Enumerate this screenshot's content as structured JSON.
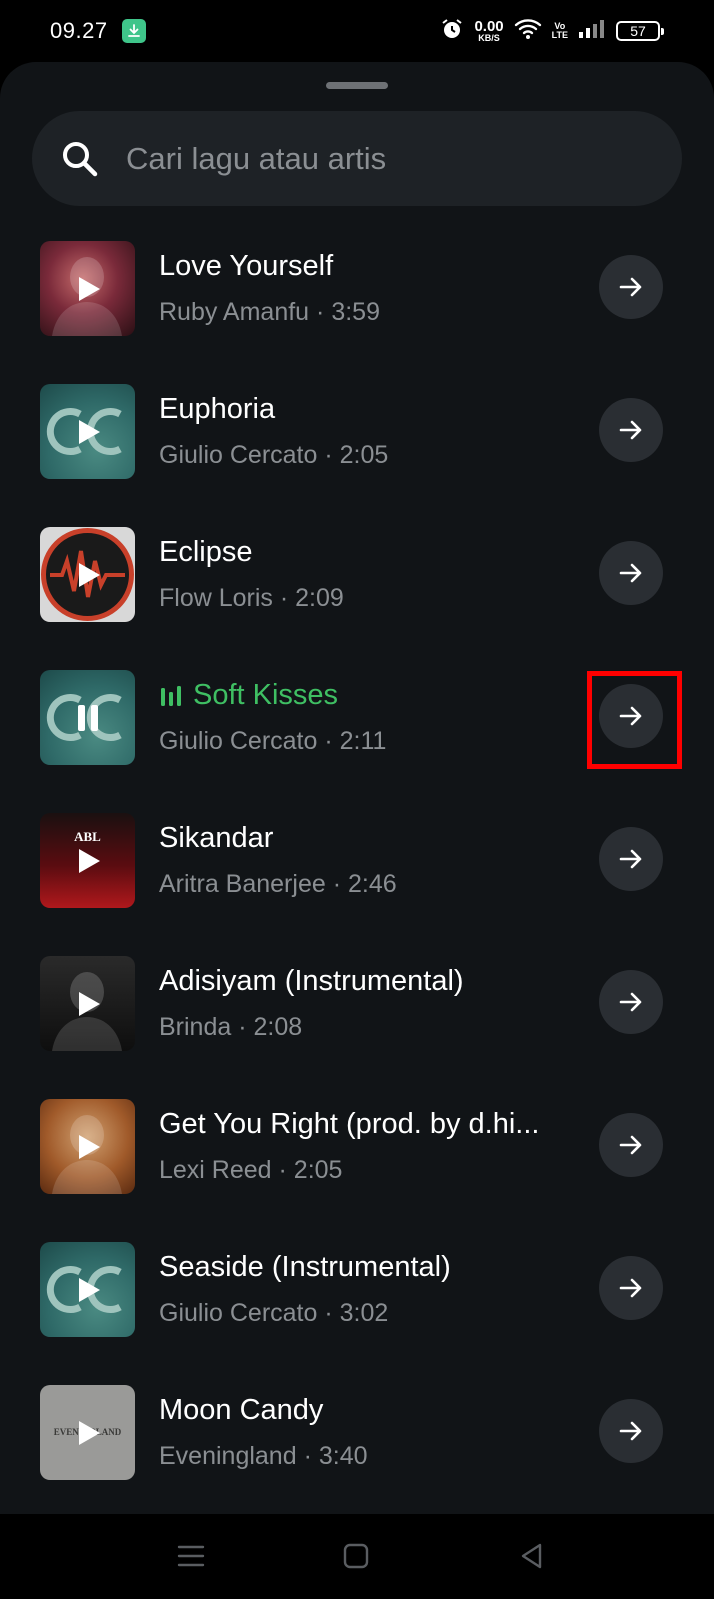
{
  "status_bar": {
    "time": "09.27",
    "net_speed_value": "0.00",
    "net_speed_unit": "KB/S",
    "volte_top": "Vo",
    "volte_bottom": "LTE",
    "battery": "57"
  },
  "search": {
    "placeholder": "Cari lagu atau artis",
    "value": ""
  },
  "songs": [
    {
      "title": "Love Yourself",
      "artist": "Ruby Amanfu",
      "duration": "3:59",
      "state": "play"
    },
    {
      "title": "Euphoria",
      "artist": "Giulio Cercato",
      "duration": "2:05",
      "state": "play"
    },
    {
      "title": "Eclipse",
      "artist": "Flow Loris",
      "duration": "2:09",
      "state": "play"
    },
    {
      "title": "Soft Kisses",
      "artist": "Giulio Cercato",
      "duration": "2:11",
      "state": "pause"
    },
    {
      "title": "Sikandar",
      "artist": "Aritra Banerjee",
      "duration": "2:46",
      "state": "play",
      "art_text": "ABL"
    },
    {
      "title": "Adisiyam (Instrumental)",
      "artist": "Brinda",
      "duration": "2:08",
      "state": "play"
    },
    {
      "title": "Get You Right (prod. by d.hi...",
      "artist": "Lexi Reed",
      "duration": "2:05",
      "state": "play"
    },
    {
      "title": "Seaside (Instrumental)",
      "artist": "Giulio Cercato",
      "duration": "3:02",
      "state": "play"
    },
    {
      "title": "Moon Candy",
      "artist": "Eveningland",
      "duration": "3:40",
      "state": "play",
      "art_text": "EVENINGLAND"
    }
  ],
  "subtitle_separator": " · ",
  "colors": {
    "sheet_bg": "#111417",
    "search_bg": "#1e2226",
    "now_playing_green": "#3fbf63",
    "secondary_text": "#8b8f93",
    "button_bg": "#2a2e33",
    "highlight_red": "#ff0000"
  },
  "icons": {
    "search": "search-icon",
    "row_action": "arrow-right-icon",
    "playing_indicator": "equalizer-icon",
    "nav_recents": "menu-icon",
    "nav_home": "square-icon",
    "nav_back": "back-triangle-icon"
  }
}
